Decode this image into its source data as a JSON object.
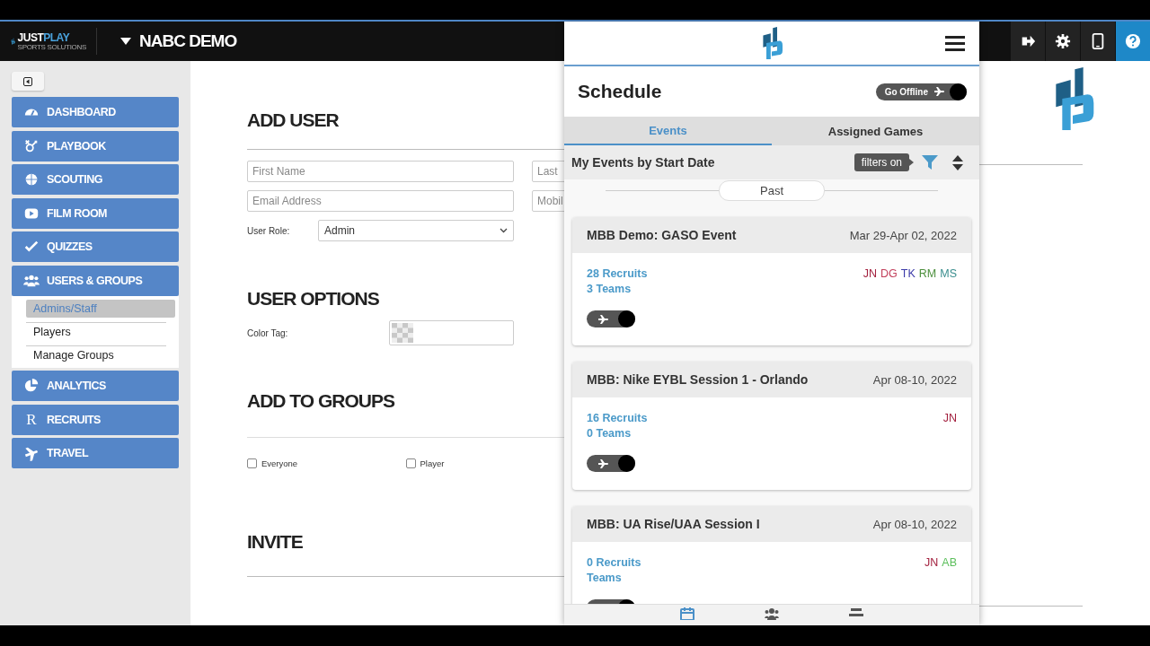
{
  "header": {
    "brand": [
      "JUST",
      "PLAY"
    ],
    "brand_sub": "SPORTS SOLUTIONS",
    "team": "NABC DEMO",
    "actions": [
      {
        "kind": "logout"
      },
      {
        "kind": "settings"
      },
      {
        "kind": "tablet"
      },
      {
        "kind": "help"
      }
    ]
  },
  "sidebar": {
    "items": [
      {
        "label": "DASHBOARD",
        "kind": "gauge"
      },
      {
        "label": "PLAYBOOK",
        "kind": "play"
      },
      {
        "label": "SCOUTING",
        "kind": "ball"
      },
      {
        "label": "FILM ROOM",
        "kind": "film"
      },
      {
        "label": "QUIZZES",
        "kind": "check"
      },
      {
        "label": "USERS & GROUPS",
        "kind": "users",
        "children": [
          {
            "label": "Admins/Staff",
            "selected": true
          },
          {
            "label": "Players",
            "selected": false
          },
          {
            "label": "Manage Groups",
            "selected": false
          }
        ]
      },
      {
        "label": "ANALYTICS",
        "kind": "pie"
      },
      {
        "label": "RECRUITS",
        "kind": "letter",
        "icon_text": "R"
      },
      {
        "label": "TRAVEL",
        "kind": "plane"
      }
    ]
  },
  "add_user": {
    "title": "ADD USER",
    "fields": [
      {
        "placeholder": "First Name"
      },
      {
        "placeholder": "Last"
      },
      {
        "placeholder": "Email Address"
      },
      {
        "placeholder": "Mobil"
      }
    ],
    "role_label": "User Role:",
    "role_value": "Admin"
  },
  "user_options": {
    "title": "USER OPTIONS",
    "color_tag_label": "Color Tag:"
  },
  "add_to_groups": {
    "title": "ADD TO GROUPS",
    "groups": [
      {
        "label": "Everyone",
        "checked": false
      },
      {
        "label": "Player",
        "checked": false
      }
    ]
  },
  "invite": {
    "title": "INVITE"
  },
  "schedule": {
    "title": "Schedule",
    "offline_label": "Go Offline",
    "tabs": [
      {
        "label": "Events",
        "selected": true
      },
      {
        "label": "Assigned Games",
        "selected": false
      }
    ],
    "list_title": "My Events by Start Date",
    "filter_badge": "filters on",
    "section": "Past",
    "events": [
      {
        "name": "MBB Demo: GASO Event",
        "dates": "Mar 29-Apr 02, 2022",
        "recruits": "28 Recruits",
        "teams": "3 Teams",
        "staff": [
          {
            "initials": "JN",
            "color": "#a3213f"
          },
          {
            "initials": "DG",
            "color": "#c2405c"
          },
          {
            "initials": "TK",
            "color": "#3b3aa8"
          },
          {
            "initials": "RM",
            "color": "#4c8f3c"
          },
          {
            "initials": "MS",
            "color": "#3a8e8e"
          }
        ]
      },
      {
        "name": "MBB: Nike EYBL Session 1 - Orlando",
        "dates": "Apr 08-10, 2022",
        "recruits": "16 Recruits",
        "teams": "0 Teams",
        "staff": [
          {
            "initials": "JN",
            "color": "#a3213f"
          }
        ]
      },
      {
        "name": "MBB: UA Rise/UAA Session I",
        "dates": "Apr 08-10, 2022",
        "recruits": "0 Recruits",
        "teams": "Teams",
        "staff": [
          {
            "initials": "JN",
            "color": "#a3213f"
          },
          {
            "initials": "AB",
            "color": "#5cbf5c"
          }
        ]
      }
    ],
    "nav": [
      {
        "kind": "calendar",
        "selected": true
      },
      {
        "kind": "people",
        "selected": false
      },
      {
        "kind": "list",
        "selected": false
      }
    ]
  }
}
